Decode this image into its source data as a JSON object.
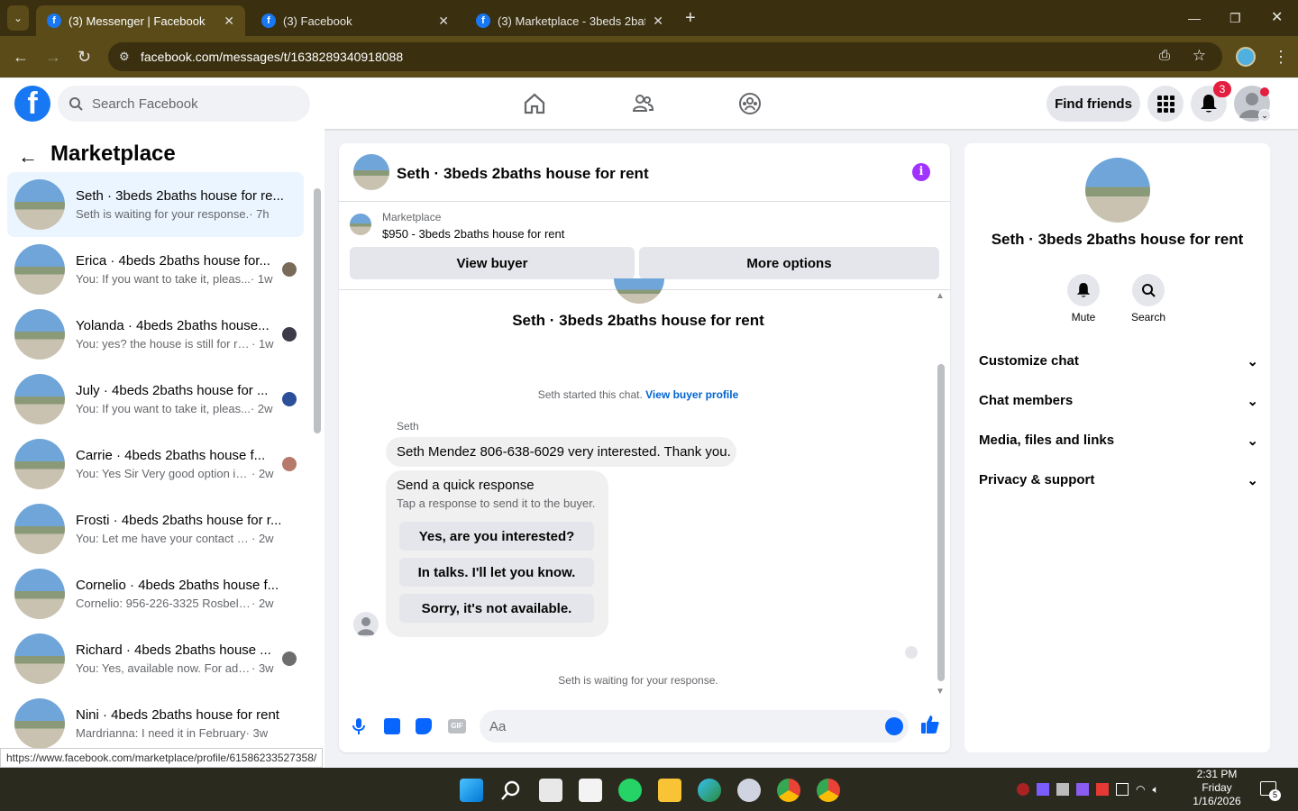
{
  "browser": {
    "tabs": [
      {
        "title": "(3) Messenger | Facebook",
        "active": true
      },
      {
        "title": "(3) Facebook",
        "active": false
      },
      {
        "title": "(3) Marketplace - 3beds 2baths",
        "active": false
      }
    ],
    "url": "facebook.com/messages/t/1638289340918088",
    "status_url": "https://www.facebook.com/marketplace/profile/61586233527358/"
  },
  "header": {
    "search_placeholder": "Search Facebook",
    "find_friends": "Find friends",
    "notif_count": "3"
  },
  "sidebar": {
    "title": "Marketplace",
    "conversations": [
      {
        "name": "Seth · 3beds 2baths house for re...",
        "preview": "Seth is waiting for your response.",
        "time": "· 7h"
      },
      {
        "name": "Erica · 4beds 2baths house for...",
        "preview": "You: If you want to take it, pleas...",
        "time": "· 1w"
      },
      {
        "name": "Yolanda · 4beds 2baths house...",
        "preview": "You: yes? the house is still for re...",
        "time": "· 1w"
      },
      {
        "name": "July · 4beds 2baths house for ...",
        "preview": "You: If you want to take it, pleas...",
        "time": "· 2w"
      },
      {
        "name": "Carrie · 4beds 2baths house f...",
        "preview": "You: Yes Sir Very good option in ...",
        "time": "· 2w"
      },
      {
        "name": "Frosti · 4beds 2baths house for r...",
        "preview": "You: Let me have your contact num...",
        "time": "· 2w"
      },
      {
        "name": "Cornelio · 4beds 2baths house f...",
        "preview": "Cornelio: 956-226-3325 Rosbel Ra...",
        "time": "· 2w"
      },
      {
        "name": "Richard · 4beds 2baths house ...",
        "preview": "You: Yes, available now. For addr...",
        "time": "· 3w"
      },
      {
        "name": "Nini · 4beds 2baths house for rent",
        "preview": "Mardrianna: I need it in February",
        "time": "· 3w"
      }
    ]
  },
  "chat": {
    "title": "Seth · 3beds 2baths house for rent",
    "listing_label": "Marketplace",
    "listing_title": "$950 - 3beds 2baths house for rent",
    "view_buyer": "View buyer",
    "more_options": "More options",
    "header_name": "Seth · 3beds 2baths house for rent",
    "started_text": "Seth started this chat.",
    "view_profile": "View buyer profile",
    "sender": "Seth",
    "message": "Seth Mendez 806-638-6029 very interested. Thank you.",
    "quick_title": "Send a quick response",
    "quick_sub": "Tap a response to send it to the buyer.",
    "quick_responses": [
      "Yes, are you interested?",
      "In talks. I'll let you know.",
      "Sorry, it's not available."
    ],
    "waiting": "Seth is waiting for your response.",
    "input_placeholder": "Aa"
  },
  "details": {
    "name": "Seth · 3beds 2baths house for rent",
    "mute": "Mute",
    "search": "Search",
    "sections": [
      "Customize chat",
      "Chat members",
      "Media, files and links",
      "Privacy & support"
    ]
  },
  "taskbar": {
    "time": "2:31 PM",
    "day": "Friday",
    "date": "1/16/2026",
    "notif": "5"
  }
}
